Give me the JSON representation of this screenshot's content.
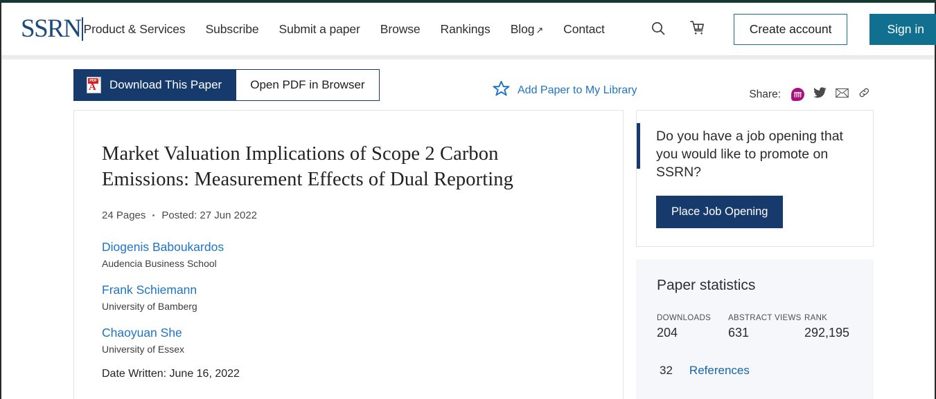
{
  "header": {
    "logo_text": "SSRN",
    "logo_icon": "ssrn-logo",
    "nav": [
      {
        "label": "Product & Services",
        "external": false
      },
      {
        "label": "Subscribe",
        "external": false
      },
      {
        "label": "Submit a paper",
        "external": false
      },
      {
        "label": "Browse",
        "external": false
      },
      {
        "label": "Rankings",
        "external": false
      },
      {
        "label": "Blog",
        "external": true,
        "arrow": "↗"
      },
      {
        "label": "Contact",
        "external": false
      }
    ],
    "search_icon": "search-icon",
    "cart_icon": "cart-icon",
    "create_account_label": "Create account",
    "sign_in_label": "Sign in",
    "accent_teal": "#11708f",
    "accent_navy": "#173a6d",
    "top_bar_color": "#123a33"
  },
  "actions": {
    "download_label": "Download This Paper",
    "download_icon": "pdf-file-icon",
    "pdf_tag": "PDF",
    "pdf_glyph": "A",
    "open_pdf_label": "Open PDF in Browser",
    "add_library_label": "Add Paper to My Library",
    "add_library_icon": "star-icon",
    "share_label": "Share:",
    "share_icons": [
      {
        "name": "mendeley-icon",
        "glyph": "m",
        "color": "#a9117f"
      },
      {
        "name": "twitter-icon",
        "glyph": "",
        "color": "#4a4a4a"
      },
      {
        "name": "email-icon",
        "glyph": "",
        "color": "#4a4a4a"
      },
      {
        "name": "copy-link-icon",
        "glyph": "",
        "color": "#4a4a4a"
      }
    ]
  },
  "paper": {
    "title": "Market Valuation Implications of Scope 2 Carbon Emissions: Measurement Effects of Dual Reporting",
    "pages": "24 Pages",
    "posted": "Posted: 27 Jun 2022",
    "authors": [
      {
        "name": "Diogenis Baboukardos",
        "affiliation": "Audencia Business School"
      },
      {
        "name": "Frank Schiemann",
        "affiliation": "University of Bamberg"
      },
      {
        "name": "Chaoyuan She",
        "affiliation": "University of Essex"
      }
    ],
    "date_written": "Date Written: June 16, 2022"
  },
  "sidebar": {
    "job_card": {
      "text": "Do you have a job opening that you would like to promote on SSRN?",
      "button_label": "Place Job Opening"
    },
    "stats": {
      "title": "Paper statistics",
      "items": [
        {
          "label": "DOWNLOADS",
          "value": "204"
        },
        {
          "label": "ABSTRACT VIEWS",
          "value": "631"
        },
        {
          "label": "RANK",
          "value": "292,195"
        }
      ],
      "references_count": "32",
      "references_label": "References"
    }
  }
}
